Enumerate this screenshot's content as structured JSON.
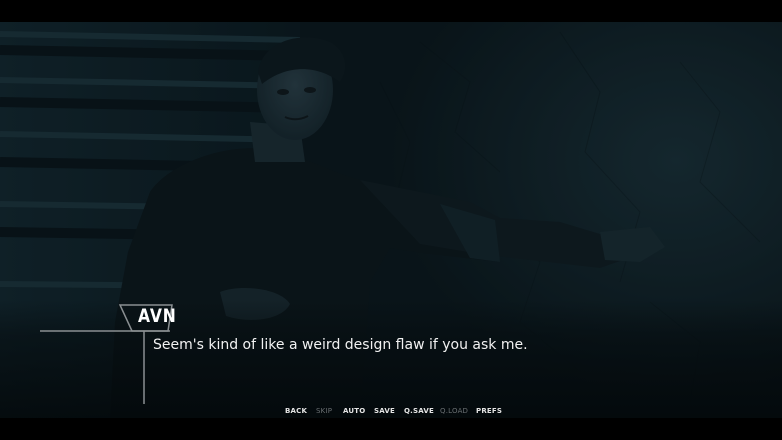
{
  "dialogue": {
    "speaker": "AVN",
    "text": "Seem's kind of like a weird design flaw if you ask me."
  },
  "quick_menu": {
    "back": "BACK",
    "skip": "SKIP",
    "auto": "AUTO",
    "save": "SAVE",
    "qsave": "Q.SAVE",
    "qload": "Q.LOAD",
    "prefs": "PREFS"
  },
  "colors": {
    "background": "#000000",
    "scene_tint": "#0d1e25",
    "text": "#ffffff",
    "disabled_menu": "#6a6f72"
  }
}
